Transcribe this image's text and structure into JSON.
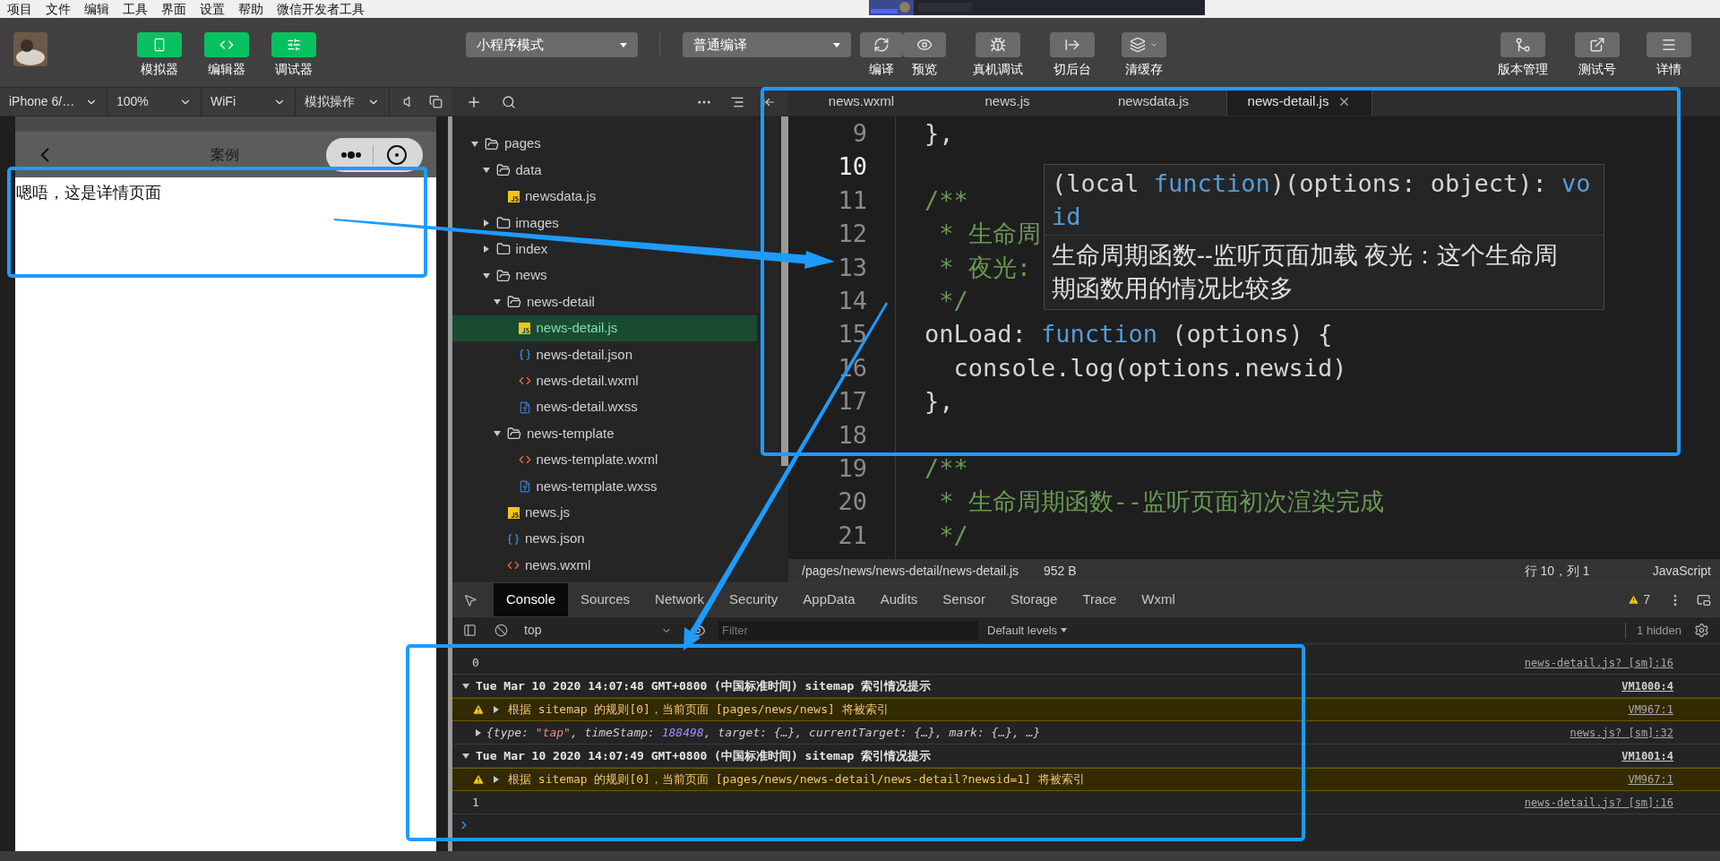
{
  "menu_bar": [
    "项目",
    "文件",
    "编辑",
    "工具",
    "界面",
    "设置",
    "帮助",
    "微信开发者工具"
  ],
  "toolbar": {
    "panel_toggles": [
      {
        "kind": "simulator",
        "label": "模拟器",
        "on": true
      },
      {
        "kind": "editor",
        "label": "编辑器",
        "on": true
      },
      {
        "kind": "debugger",
        "label": "调试器",
        "on": true
      }
    ],
    "mode_select": "小程序模式",
    "compile_select": "普通编译",
    "actions": [
      {
        "kind": "compile",
        "label": "编译"
      },
      {
        "kind": "preview",
        "label": "预览"
      },
      {
        "kind": "debug",
        "label": "真机调试"
      },
      {
        "kind": "background",
        "label": "切后台"
      },
      {
        "kind": "cache",
        "label": "清缓存"
      }
    ],
    "right_actions": [
      {
        "kind": "version",
        "label": "版本管理"
      },
      {
        "kind": "test",
        "label": "测试号"
      },
      {
        "kind": "details",
        "label": "详情"
      }
    ]
  },
  "simulator": {
    "device": "iPhone 6/…",
    "zoom": "100%",
    "network": "WiFi",
    "operation": "模拟操作",
    "nav_title": "案例",
    "content": "嗯唔，这是详情页面"
  },
  "file_tree": [
    {
      "name": "pages",
      "kind": "folder",
      "expanded": true,
      "selected": false,
      "children": [
        {
          "name": "data",
          "kind": "folder",
          "expanded": true,
          "selected": false,
          "children": [
            {
              "name": "newsdata.js",
              "kind": "js",
              "selected": false
            }
          ]
        },
        {
          "name": "images",
          "kind": "folder",
          "expanded": false,
          "selected": false
        },
        {
          "name": "index",
          "kind": "folder",
          "expanded": false,
          "selected": false
        },
        {
          "name": "news",
          "kind": "folder",
          "expanded": true,
          "selected": false,
          "children": [
            {
              "name": "news-detail",
              "kind": "folder",
              "expanded": true,
              "selected": false,
              "children": [
                {
                  "name": "news-detail.js",
                  "kind": "js",
                  "selected": true
                },
                {
                  "name": "news-detail.json",
                  "kind": "json",
                  "selected": false
                },
                {
                  "name": "news-detail.wxml",
                  "kind": "wxml",
                  "selected": false
                },
                {
                  "name": "news-detail.wxss",
                  "kind": "wxss",
                  "selected": false
                }
              ]
            },
            {
              "name": "news-template",
              "kind": "folder",
              "expanded": true,
              "selected": false,
              "children": [
                {
                  "name": "news-template.wxml",
                  "kind": "wxml",
                  "selected": false
                },
                {
                  "name": "news-template.wxss",
                  "kind": "wxss",
                  "selected": false
                }
              ]
            },
            {
              "name": "news.js",
              "kind": "js",
              "selected": false
            },
            {
              "name": "news.json",
              "kind": "json",
              "selected": false
            },
            {
              "name": "news.wxml",
              "kind": "wxml",
              "selected": false
            }
          ]
        }
      ]
    }
  ],
  "editor": {
    "tabs": [
      {
        "label": "news.wxml",
        "selected": false
      },
      {
        "label": "news.js",
        "selected": false
      },
      {
        "label": "newsdata.js",
        "selected": false
      },
      {
        "label": "news-detail.js",
        "selected": true
      }
    ],
    "lines": [
      {
        "number": "9",
        "current": false,
        "tokens": [
          {
            "kind": "plain",
            "text": "},"
          }
        ]
      },
      {
        "number": "10",
        "current": true
      },
      {
        "number": "11",
        "current": false,
        "tokens": [
          {
            "kind": "comment",
            "text": "/**"
          }
        ]
      },
      {
        "number": "12",
        "current": false,
        "tokens": [
          {
            "kind": "comment",
            "text": " * 生命周"
          }
        ]
      },
      {
        "number": "13",
        "current": false,
        "tokens": [
          {
            "kind": "comment",
            "text": " * 夜光:"
          }
        ]
      },
      {
        "number": "14",
        "current": false,
        "tokens": [
          {
            "kind": "comment",
            "text": " */"
          }
        ]
      },
      {
        "number": "15",
        "current": false,
        "tokens": [
          {
            "kind": "plain",
            "text": "onLoad: "
          },
          {
            "kind": "keyword",
            "text": "function"
          },
          {
            "kind": "plain",
            "text": " (options) {"
          }
        ]
      },
      {
        "number": "16",
        "current": false,
        "tokens": [
          {
            "kind": "plain",
            "text": "  console.log(options.newsid)"
          }
        ]
      },
      {
        "number": "17",
        "current": false,
        "tokens": [
          {
            "kind": "plain",
            "text": "},"
          }
        ]
      },
      {
        "number": "18",
        "current": false
      },
      {
        "number": "19",
        "current": false,
        "tokens": [
          {
            "kind": "comment",
            "text": "/**"
          }
        ]
      },
      {
        "number": "20",
        "current": false,
        "tokens": [
          {
            "kind": "comment",
            "text": " * 生命周期函数--监听页面初次渲染完成"
          }
        ]
      },
      {
        "number": "21",
        "current": false,
        "tokens": [
          {
            "kind": "comment",
            "text": " */"
          }
        ]
      }
    ],
    "tooltip": {
      "signature": [
        {
          "kind": "plain",
          "text": "(local "
        },
        {
          "kind": "keyword",
          "text": "function"
        },
        {
          "kind": "plain",
          "text": ")(options: object): "
        },
        {
          "kind": "keyword",
          "text": "void"
        }
      ],
      "description": "生命周期函数--监听页面加载 夜光：这个生命周期函数用的情况比较多"
    },
    "status": {
      "path": "/pages/news/news-detail/news-detail.js",
      "size": "952 B",
      "position": "行 10，列 1",
      "language": "JavaScript"
    }
  },
  "devtools": {
    "tabs": [
      {
        "label": "Console",
        "selected": true
      },
      {
        "label": "Sources",
        "selected": false
      },
      {
        "label": "Network",
        "selected": false
      },
      {
        "label": "Security",
        "selected": false
      },
      {
        "label": "AppData",
        "selected": false
      },
      {
        "label": "Audits",
        "selected": false
      },
      {
        "label": "Sensor",
        "selected": false
      },
      {
        "label": "Storage",
        "selected": false
      },
      {
        "label": "Trace",
        "selected": false
      },
      {
        "label": "Wxml",
        "selected": false
      }
    ],
    "warning_count": "7",
    "context": "top",
    "filter_placeholder": "Filter",
    "levels": "Default levels",
    "hidden": "1 hidden",
    "logs": [
      {
        "kind": "value",
        "text": "0",
        "source": "news-detail.js? [sm]:16"
      },
      {
        "kind": "group",
        "expanded": true,
        "text": "Tue Mar 10 2020 14:07:48 GMT+0800 (中国标准时间) sitemap 索引情况提示",
        "source": "VM1000:4"
      },
      {
        "kind": "warning",
        "expanded": false,
        "text": "根据 sitemap 的规则[0]，当前页面 [pages/news/news] 将被索引",
        "source": "VM967:1"
      },
      {
        "kind": "object",
        "expanded": false,
        "tokens": [
          {
            "kind": "text",
            "text": "{type: "
          },
          {
            "kind": "string",
            "text": "\"tap\""
          },
          {
            "kind": "text",
            "text": ", timeStamp: "
          },
          {
            "kind": "number",
            "text": "188498"
          },
          {
            "kind": "text",
            "text": ", target: {…}, currentTarget: {…}, mark: {…}, …}"
          }
        ],
        "source": "news.js? [sm]:32"
      },
      {
        "kind": "group",
        "expanded": true,
        "text": "Tue Mar 10 2020 14:07:49 GMT+0800 (中国标准时间) sitemap 索引情况提示",
        "source": "VM1001:4"
      },
      {
        "kind": "warning",
        "expanded": false,
        "text": "根据 sitemap 的规则[0]，当前页面 [pages/news/news-detail/news-detail?newsid=1] 将被索引",
        "source": "VM967:1"
      },
      {
        "kind": "value",
        "text": "1",
        "source": "news-detail.js? [sm]:16"
      }
    ]
  }
}
